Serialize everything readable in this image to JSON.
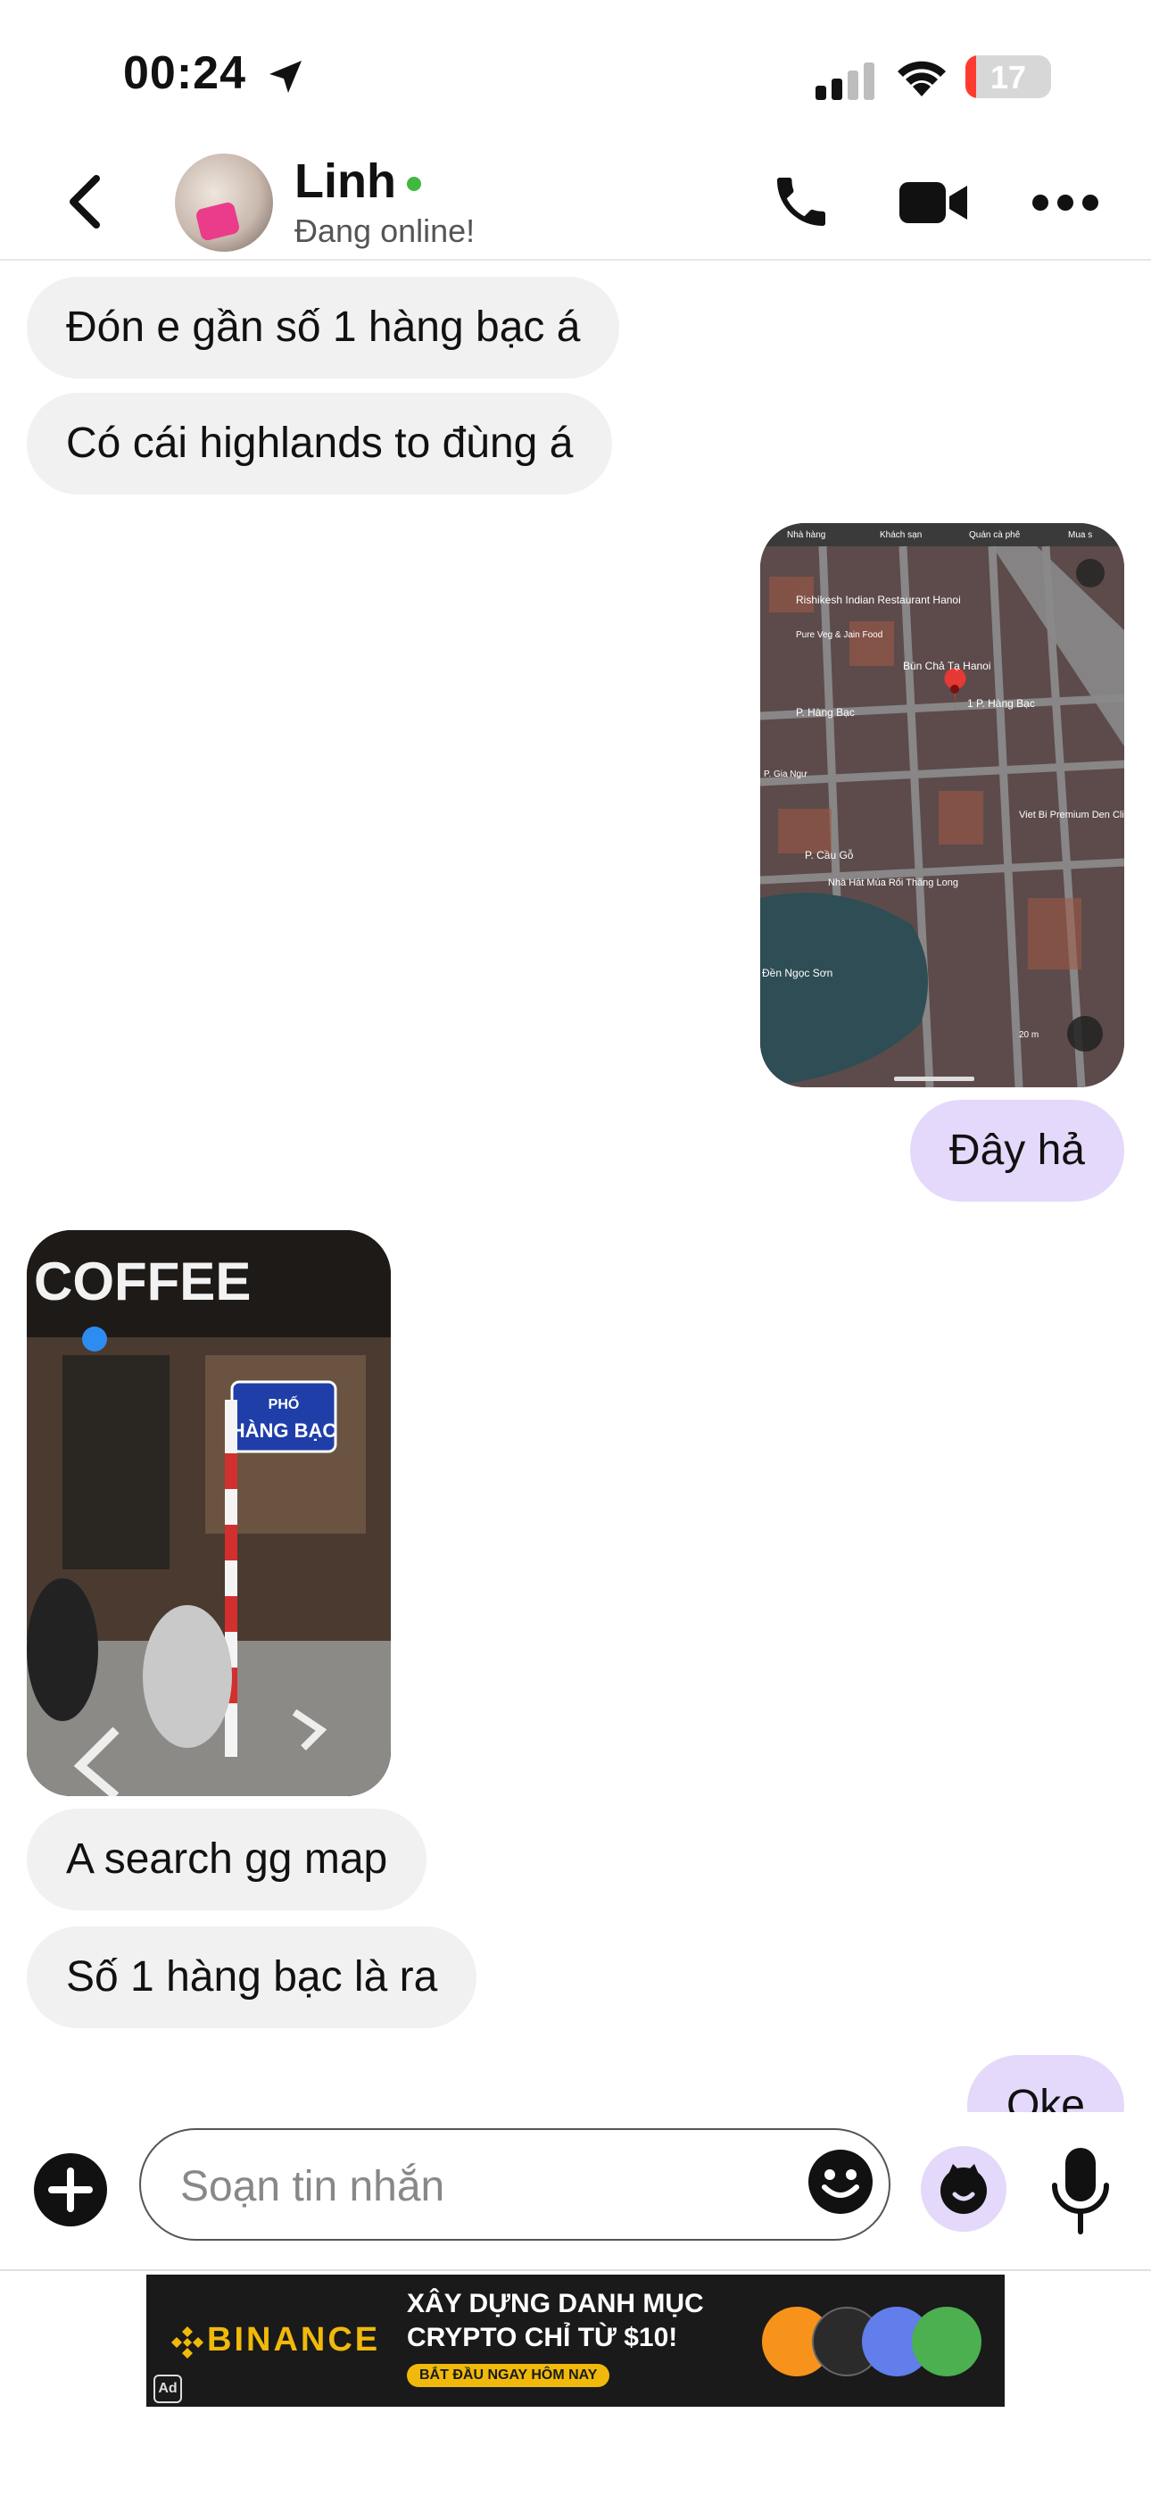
{
  "status_bar": {
    "time": "00:24",
    "battery": "17"
  },
  "header": {
    "contact_name": "Linh",
    "contact_status": "Đang online!"
  },
  "messages": [
    {
      "side": "in",
      "type": "text",
      "text": "Đón e gần số 1 hàng bạc á"
    },
    {
      "side": "in",
      "type": "text",
      "text": "Có cái highlands to đùng á"
    },
    {
      "side": "out",
      "type": "image",
      "description": "map"
    },
    {
      "side": "out",
      "type": "text",
      "text": "Đây hả"
    },
    {
      "side": "in",
      "type": "image",
      "description": "street-view"
    },
    {
      "side": "in",
      "type": "text",
      "text": "A search gg map"
    },
    {
      "side": "in",
      "type": "text",
      "text": "Số 1 hàng bạc là ra"
    },
    {
      "side": "out",
      "type": "text",
      "text": "Oke"
    }
  ],
  "map_image": {
    "labels": {
      "tab1": "Nhà hàng",
      "tab2": "Khách sạn",
      "tab3": "Quán cà phê",
      "tab4": "Mua s",
      "restaurant": "Rishikesh Indian Restaurant Hanoi",
      "restaurant_sub": "Pure Veg & Jain Food",
      "bun_cha": "Bún Chả Tạ Hanoi",
      "pin_label": "1 P. Hàng Bạc",
      "hang_bac": "P. Hàng Bạc",
      "gia_ngu": "P. Gia Ngư",
      "cau_go": "P. Cầu Gỗ",
      "clinic": "Viet Bi Premium Den Clinic",
      "theater": "Nhà Hát Múa Rối Thăng Long",
      "den_ngoc_son": "Đền Ngọc Sơn",
      "scale": "20 m"
    }
  },
  "street_image": {
    "labels": {
      "coffee": "COFFEE",
      "sign_top": "PHỐ",
      "sign_bottom": "HÀNG BẠC"
    }
  },
  "input": {
    "placeholder": "Soạn tin nhắn"
  },
  "ad": {
    "brand": "BINANCE",
    "line1": "XÂY DỰNG DANH MỤC",
    "line2": "CRYPTO CHỈ TỪ $10!",
    "cta": "BẮT ĐẦU NGAY HÔM NAY",
    "badge": "Ad"
  },
  "colors": {
    "incoming_bubble": "#f1f1f1",
    "outgoing_bubble": "#e4d9fb",
    "online": "#3fb93f",
    "battery_low": "#ff3b30",
    "binance": "#f0b90b"
  }
}
